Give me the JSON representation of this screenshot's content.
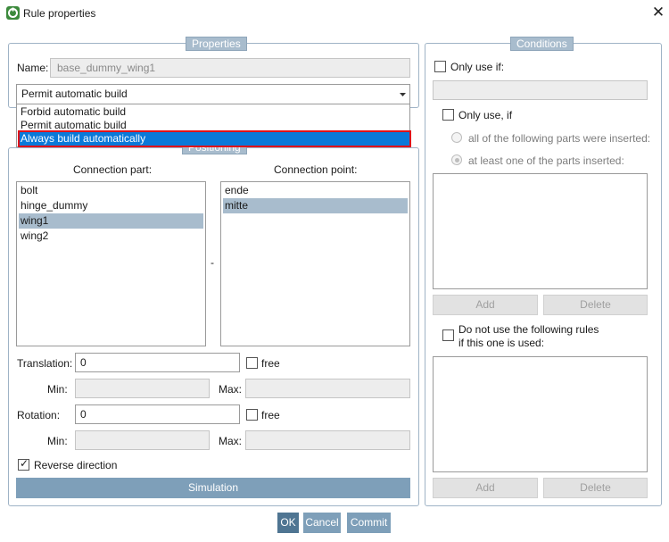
{
  "window": {
    "title": "Rule properties",
    "close_symbol": "✕"
  },
  "properties": {
    "title": "Properties",
    "name_label": "Name:",
    "name_value": "base_dummy_wing1",
    "build_select": {
      "selected": "Permit automatic build",
      "options": [
        "Forbid automatic build",
        "Permit automatic build",
        "Always build automatically"
      ],
      "highlighted_option": "Always build automatically"
    }
  },
  "positioning": {
    "title": "Positioning",
    "connection_part_label": "Connection part:",
    "connection_point_label": "Connection point:",
    "separator": "-",
    "parts": [
      "bolt",
      "hinge_dummy",
      "wing1",
      "wing2"
    ],
    "selected_part": "wing1",
    "points": [
      "ende",
      "mitte"
    ],
    "selected_point": "mitte",
    "translation_label": "Translation:",
    "translation_value": "0",
    "rotation_label": "Rotation:",
    "rotation_value": "0",
    "free_label": "free",
    "min_label": "Min:",
    "max_label": "Max:",
    "reverse_label": "Reverse direction",
    "reverse_checked": true,
    "simulation_label": "Simulation"
  },
  "conditions": {
    "title": "Conditions",
    "only_use_if_label": "Only use if:",
    "only_use_if2_label": "Only use, if",
    "radio_all_label": "all of the following parts were inserted:",
    "radio_one_label": "at least one of the parts inserted:",
    "add_label": "Add",
    "delete_label": "Delete",
    "do_not_use_label_1": "Do not use the following rules",
    "do_not_use_label_2": "if this one is used:"
  },
  "footer": {
    "ok_label": "OK",
    "cancel_label": "Cancel",
    "commit_label": "Commit"
  },
  "colors": {
    "accent": "#a8bccd",
    "selection": "#0a79d9",
    "highlight_border": "#e0121a",
    "button": "#7e9fb9"
  }
}
